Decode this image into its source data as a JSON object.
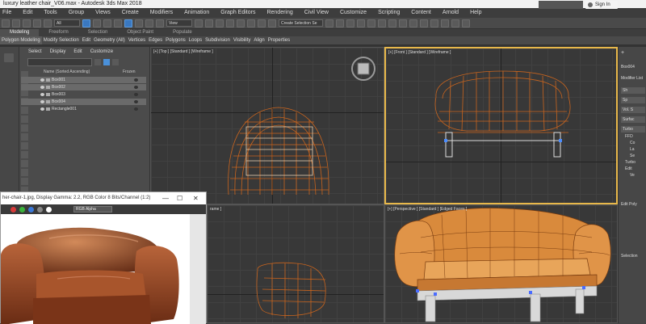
{
  "window": {
    "title": "luxury leather chair_V06.max - Autodesk 3ds Max 2018"
  },
  "menu": [
    "File",
    "Edit",
    "Tools",
    "Group",
    "Views",
    "Create",
    "Modifiers",
    "Animation",
    "Graph Editors",
    "Rendering",
    "Civil View",
    "Customize",
    "Scripting",
    "Content",
    "Arnold",
    "Help"
  ],
  "account": {
    "signin_label": "Sign In"
  },
  "toolbar": {
    "filter_value": "All",
    "view_value": "View",
    "selection_set_value": "Create Selection Se"
  },
  "ribbon": {
    "tabs": [
      "Modeling",
      "Freeform",
      "Selection",
      "Object Paint",
      "Populate"
    ],
    "subtabs": [
      "Polygon Modeling",
      "Modify Selection",
      "Edit",
      "Geometry (All)",
      "Vertices",
      "Edges",
      "Polygons",
      "Loops",
      "Subdivision",
      "Visibility",
      "Align",
      "Properties"
    ]
  },
  "explorer": {
    "menu": [
      "Select",
      "Display",
      "Edit",
      "Customize"
    ],
    "columns": {
      "name": "Name (Sorted Ascending)",
      "frozen": "Frozen"
    },
    "rows": [
      {
        "name": "Box001",
        "selected": true
      },
      {
        "name": "Box002",
        "selected": true
      },
      {
        "name": "Box003",
        "selected": false
      },
      {
        "name": "Box004",
        "selected": true
      },
      {
        "name": "Rectangle001",
        "selected": false
      }
    ]
  },
  "viewports": {
    "top": "[+] [Top ] [Standard ] [Wireframe ]",
    "front": "[+] [Front ] [Standard ] [Wireframe ]",
    "left": "rame ]",
    "perspective": "[+] [Perspective ] [Standard ] [Edged Faces ]"
  },
  "command_panel": {
    "object_name": "Box004",
    "modifier_list": "Modifier List",
    "buttons": [
      "Sh",
      "Sp",
      "Vol. S",
      "Surfac",
      "Turbo"
    ],
    "stack": [
      "FFD",
      "Co",
      "La",
      "Se",
      "Turbo",
      "Edit",
      "Ve"
    ],
    "rollout_edit_poly": "Edit Poly",
    "rollout_selection": "Selection"
  },
  "image_viewer": {
    "title": "her-chair-1.jpg, Display Gamma: 2.2, RGB Color 8 Bits/Channel (1:2)",
    "channel": "RGB Alpha",
    "dots": [
      "#d83a3a",
      "#3ab43a",
      "#3a78d8",
      "#888888",
      "#ffffff"
    ]
  },
  "colors": {
    "accent": "#e8b84a",
    "wire": "#c8641e",
    "model": "#d98a3c"
  }
}
